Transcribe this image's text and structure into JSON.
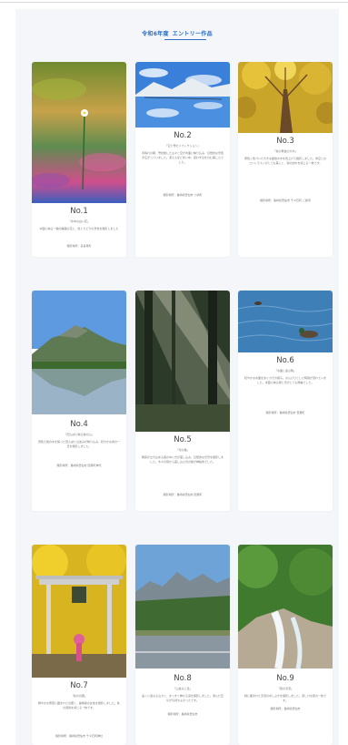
{
  "page": {
    "title_year": "令和6年度",
    "title_main": "エントリー作品"
  },
  "entries": [
    {
      "no": "No.1",
      "subtitle": "「水中の白い花」",
      "description": "水面に映る一輪の睡蓮の花と、色とりどりの景色を撮影しました",
      "location": "撮影場所：多良見町"
    },
    {
      "no": "No.2",
      "subtitle": "「空と雪のリフレクション」",
      "description": "冬晴れの朝、雪化粧した山々と空が水面に映り込み、幻想的な景色が広がっていました。凍えるほど寒い中、思わず息をのむ美しさでした。",
      "location": "撮影場所：長崎県雲仙市 小浜町"
    },
    {
      "no": "No.3",
      "subtitle": "「秋の黄金の大木」",
      "description": "黄色く色づいた大きな銀杏の木を見上げて撮影しました。青空とのコントラストがとても美しく、秋の訪れを感じる一枚です。",
      "location": "撮影場所：長崎県雲仙市 千々石町 ご飯寺"
    },
    {
      "no": "No.4",
      "subtitle": "「田んぼに映る春の山」",
      "description": "田植え前の水を張った田んぼに山並みが映り込み、穏やかな春の一日を撮影しました。",
      "location": "撮影場所：長崎県雲仙市 国見町神代"
    },
    {
      "no": "No.5",
      "subtitle": "「光の森」",
      "description": "朝霧が立ち込める森の中に光が差し込み、幻想的な光景を撮影しました。木々の間から差し込む光の筋が神秘的でした。",
      "location": "撮影場所：長崎県雲仙市 国見町"
    },
    {
      "no": "No.6",
      "subtitle": "「水面に遊ぶ鴨」",
      "description": "穏やかな水面を泳ぐカモの親子。のんびりとした時間が流れていました。水面に映る緑と光がとても綺麗でした。",
      "location": "撮影場所：長崎県雲仙市 吾妻町"
    },
    {
      "no": "No.7",
      "subtitle": "「秋の鳥居」",
      "description": "鮮やかな黄葉に囲まれた鳥居と、着物姿の女性を撮影しました。秋の風情を感じる一枚です。",
      "location": "撮影場所：長崎県雲仙市 千々石町神社"
    },
    {
      "no": "No.8",
      "subtitle": "「山並みと道」",
      "description": "遠くに連なる山々と、まっすぐ伸びる道を撮影しました。澄んだ空気が気持ちよかったです。",
      "location": "撮影場所：長崎県雲仙市"
    },
    {
      "no": "No.9",
      "subtitle": "「夏の渓流」",
      "description": "緑に囲まれた渓流の水しぶきを撮影しました。涼しげな夏の一枚です。",
      "location": "撮影場所：長崎県雲仙市"
    }
  ]
}
